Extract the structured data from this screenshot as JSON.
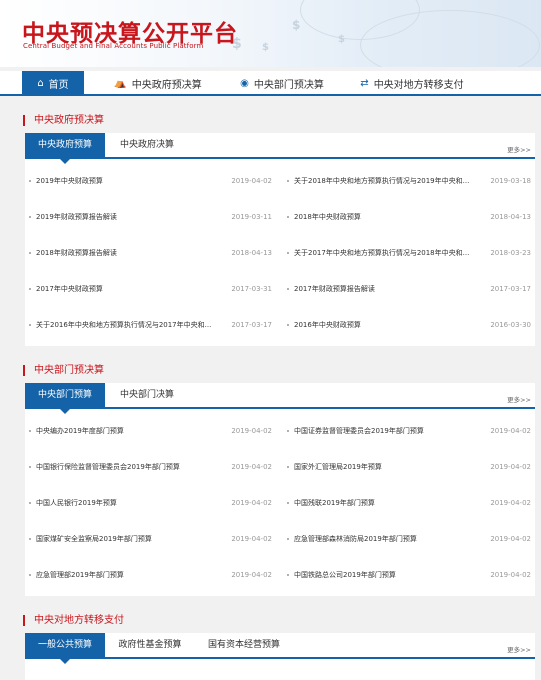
{
  "brand": {
    "title_cn": "中央预决算公开平台",
    "title_en": "Central Budget and Final Accounts Public Platform"
  },
  "nav": {
    "items": [
      {
        "label": "首页",
        "icon": "home-icon",
        "active": true
      },
      {
        "label": "中央政府预决算",
        "icon": "bank-icon",
        "active": false
      },
      {
        "label": "中央部门预决算",
        "icon": "globe-icon",
        "active": false
      },
      {
        "label": "中央对地方转移支付",
        "icon": "transfer-icon",
        "active": false
      }
    ]
  },
  "sections": [
    {
      "title": "中央政府预决算",
      "tabs": [
        {
          "label": "中央政府预算",
          "active": true
        },
        {
          "label": "中央政府决算",
          "active": false
        }
      ],
      "more": "更多>>",
      "rows": [
        {
          "left": {
            "title": "2019年中央财政预算",
            "date": "2019-04-02"
          },
          "right": {
            "title": "关于2018年中央和地方预算执行情况与2019年中央和...",
            "date": "2019-03-18"
          }
        },
        {
          "left": {
            "title": "2019年财政预算报告解读",
            "date": "2019-03-11"
          },
          "right": {
            "title": "2018年中央财政预算",
            "date": "2018-04-13"
          }
        },
        {
          "left": {
            "title": "2018年财政预算报告解读",
            "date": "2018-04-13"
          },
          "right": {
            "title": "关于2017年中央和地方预算执行情况与2018年中央和...",
            "date": "2018-03-23"
          }
        },
        {
          "left": {
            "title": "2017年中央财政预算",
            "date": "2017-03-31"
          },
          "right": {
            "title": "2017年财政预算报告解读",
            "date": "2017-03-17"
          }
        },
        {
          "left": {
            "title": "关于2016年中央和地方预算执行情况与2017年中央和...",
            "date": "2017-03-17"
          },
          "right": {
            "title": "2016年中央财政预算",
            "date": "2016-03-30"
          }
        }
      ]
    },
    {
      "title": "中央部门预决算",
      "tabs": [
        {
          "label": "中央部门预算",
          "active": true
        },
        {
          "label": "中央部门决算",
          "active": false
        }
      ],
      "more": "更多>>",
      "rows": [
        {
          "left": {
            "title": "中央编办2019年度部门预算",
            "date": "2019-04-02"
          },
          "right": {
            "title": "中国证券监督管理委员会2019年部门预算",
            "date": "2019-04-02"
          }
        },
        {
          "left": {
            "title": "中国银行保险监督管理委员会2019年部门预算",
            "date": "2019-04-02"
          },
          "right": {
            "title": "国家外汇管理局2019年预算",
            "date": "2019-04-02"
          }
        },
        {
          "left": {
            "title": "中国人民银行2019年预算",
            "date": "2019-04-02"
          },
          "right": {
            "title": "中国残联2019年部门预算",
            "date": "2019-04-02"
          }
        },
        {
          "left": {
            "title": "国家煤矿安全监察局2019年部门预算",
            "date": "2019-04-02"
          },
          "right": {
            "title": "应急管理部森林消防局2019年部门预算",
            "date": "2019-04-02"
          }
        },
        {
          "left": {
            "title": "应急管理部2019年部门预算",
            "date": "2019-04-02"
          },
          "right": {
            "title": "中国铁路总公司2019年部门预算",
            "date": "2019-04-02"
          }
        }
      ]
    },
    {
      "title": "中央对地方转移支付",
      "tabs": [
        {
          "label": "一般公共预算",
          "active": true
        },
        {
          "label": "政府性基金预算",
          "active": false
        },
        {
          "label": "国有资本经营预算",
          "active": false
        }
      ],
      "more": "更多>>",
      "rows": []
    }
  ],
  "colors": {
    "brand_red": "#c8161d",
    "nav_blue": "#1463a8",
    "date_gray": "#999999"
  }
}
